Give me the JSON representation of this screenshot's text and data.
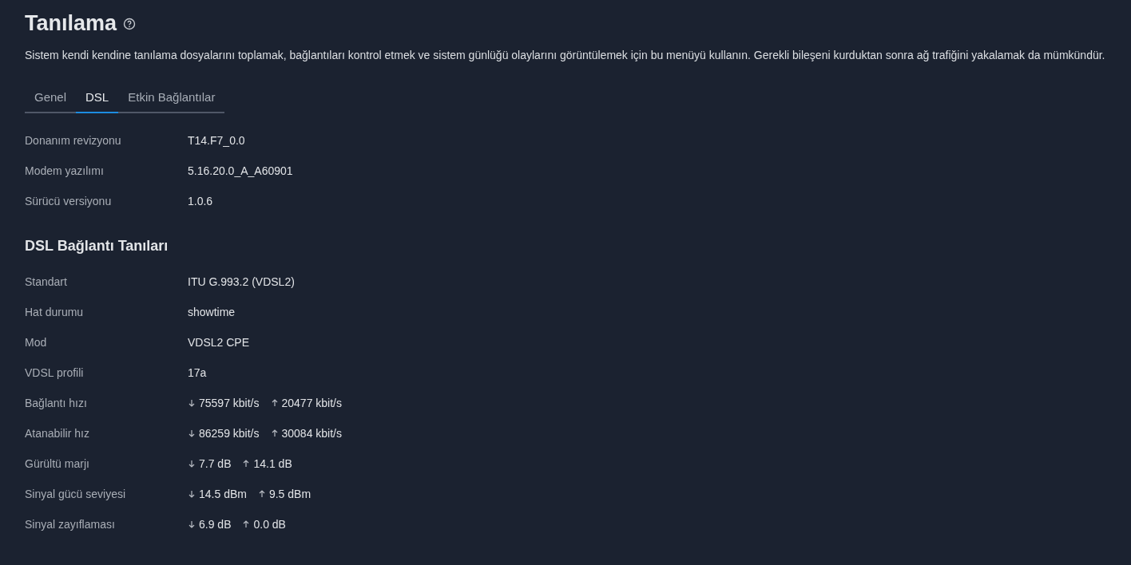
{
  "title": "Tanılama",
  "description": "Sistem kendi kendine tanılama dosyalarını toplamak, bağlantıları kontrol etmek ve sistem günlüğü olaylarını görüntülemek için bu menüyü kullanın. Gerekli bileşeni kurduktan sonra ağ trafiğini yakalamak da mümkündür.",
  "tabs": [
    {
      "label": "Genel",
      "selected": false
    },
    {
      "label": "DSL",
      "selected": true
    },
    {
      "label": "Etkin Bağlantılar",
      "selected": false
    }
  ],
  "info": [
    {
      "kind": "text",
      "label": "Donanım revizyonu",
      "value": "T14.F7_0.0"
    },
    {
      "kind": "text",
      "label": "Modem yazılımı",
      "value": "5.16.20.0_A_A60901"
    },
    {
      "kind": "text",
      "label": "Sürücü versiyonu",
      "value": "1.0.6"
    }
  ],
  "section": {
    "title": "DSL Bağlantı Tanıları",
    "rows": [
      {
        "kind": "text",
        "label": "Standart",
        "value": "ITU G.993.2 (VDSL2)"
      },
      {
        "kind": "text",
        "label": "Hat durumu",
        "value": "showtime"
      },
      {
        "kind": "text",
        "label": "Mod",
        "value": "VDSL2 CPE"
      },
      {
        "kind": "text",
        "label": "VDSL profili",
        "value": "17a"
      },
      {
        "kind": "updown",
        "label": "Bağlantı hızı",
        "down": "75597 kbit/s",
        "up": "20477 kbit/s"
      },
      {
        "kind": "updown",
        "label": "Atanabilir hız",
        "down": "86259 kbit/s",
        "up": "30084 kbit/s"
      },
      {
        "kind": "updown",
        "label": "Gürültü marjı",
        "down": "7.7 dB",
        "up": "14.1 dB"
      },
      {
        "kind": "updown",
        "label": "Sinyal gücü seviyesi",
        "down": "14.5 dBm",
        "up": "9.5 dBm"
      },
      {
        "kind": "updown",
        "label": "Sinyal zayıflaması",
        "down": "6.9 dB",
        "up": "0.0 dB"
      }
    ]
  }
}
